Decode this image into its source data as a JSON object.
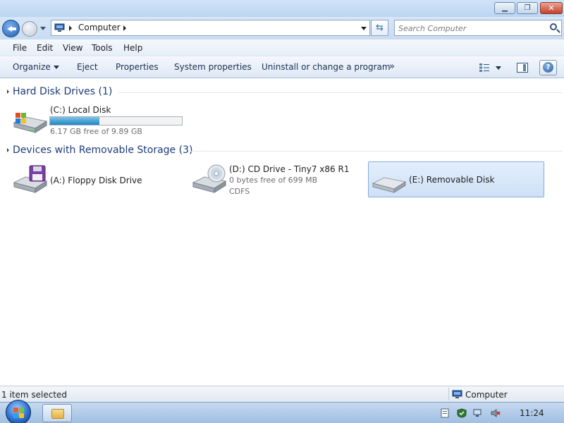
{
  "window": {
    "min_glyph": "▁",
    "max_glyph": "❐",
    "close_glyph": "✕"
  },
  "address": {
    "location": "Computer",
    "search_placeholder": "Search Computer"
  },
  "menu": {
    "file": "File",
    "edit": "Edit",
    "view": "View",
    "tools": "Tools",
    "help": "Help"
  },
  "commands": {
    "organize": "Organize",
    "eject": "Eject",
    "properties": "Properties",
    "system_properties": "System properties",
    "uninstall": "Uninstall or change a program",
    "more": "»",
    "help_glyph": "?"
  },
  "groups": {
    "hard_disks": "Hard Disk Drives (1)",
    "removable": "Devices with Removable Storage (3)"
  },
  "drives": {
    "c": {
      "name": "(C:) Local Disk",
      "free": "6.17 GB free of 9.89 GB",
      "used_fraction": 0.376
    },
    "a": {
      "name": "(A:) Floppy Disk Drive"
    },
    "d": {
      "name": "(D:) CD Drive - Tiny7 x86 R1",
      "free": "0 bytes free of 699 MB",
      "fs": "CDFS"
    },
    "e": {
      "name": "(E:) Removable Disk",
      "selected": true
    }
  },
  "status": {
    "selection": "1 item selected",
    "location": "Computer"
  },
  "taskbar": {
    "clock": "11:24"
  },
  "colors": {
    "accent": "#1e3b7a",
    "capacity_fill": "#1f87c4",
    "selection_bg": "#cfe1f7"
  }
}
